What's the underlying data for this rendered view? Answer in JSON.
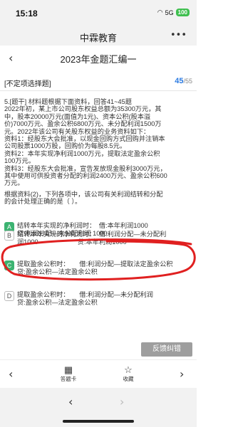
{
  "status": {
    "time": "15:18",
    "network": "5G",
    "battery": "100"
  },
  "app": {
    "title": "中霖教育",
    "menu_icon": "more-dots-icon"
  },
  "header": {
    "title": "2023年金题汇编一",
    "back_icon": "chevron-left-icon"
  },
  "question_meta": {
    "type_label": "[不定项选择题]",
    "current": "45",
    "total": "/55"
  },
  "question": {
    "lines": [
      "5.[题干] 材料题根据下面资料，回答41~45题",
      "2022年初，某上市公司股东权益总额为35300万元，其",
      "中，股本20000万元(面值为1元)、资本公积(股本溢",
      "价)7000万元、盈余公积6800万元、未分配利润1500万",
      "元。2022年该公司有关股东权益的业务资料如下：",
      "资料1：经股东大会批准，以现金回购方式回购并注销本",
      "公司股票1000万股，回购价为每股8.5元。",
      "资料2：本年实现净利润1000万元，提取法定盈余公积",
      "100万元。",
      "资料3：经股东大会批准，宣告发放现金股利3000万元，",
      "其中使用可供投资者分配的利润2400万元、盈余公积600",
      "万元。"
    ],
    "ask_lines": [
      "根据资料(2)，下列各项中，该公司有关利润结转和分配",
      "的会计处理正确的是（  ）。"
    ]
  },
  "options": [
    {
      "letter": "A",
      "lines": [
        "结转本年实现的净利润时：　借:本年利润1000",
        "贷:利润分配—未分配利润 1000"
      ]
    },
    {
      "letter": "B",
      "lines": [
        "结转本年实现的净利润时：　借:利润分配—未分配利",
        "润1000　　　　　　贷:本年利润1000"
      ]
    },
    {
      "letter": "C",
      "lines": [
        "提取盈余公积时：　　借:利润分配—提取法定盈余公积",
        "贷:盈余公积—法定盈余公积"
      ]
    },
    {
      "letter": "D",
      "lines": [
        "提取盈余公积时：　　借:利润分配—未分配利润",
        "贷:盈余公积—法定盈余公积"
      ]
    }
  ],
  "feedback_label": "反馈纠错",
  "toolbar": {
    "answer_card": "答题卡",
    "favorite": "收藏"
  },
  "colors": {
    "accent": "#2a7ae2",
    "correct_option": "#3cb371",
    "annotation": "#e02020"
  }
}
